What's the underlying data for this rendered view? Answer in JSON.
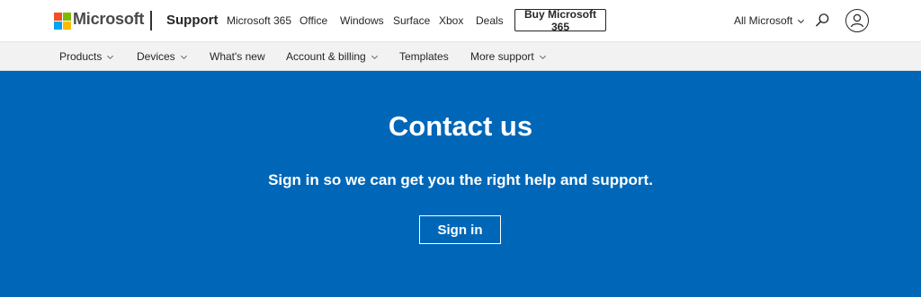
{
  "header": {
    "brand": "Microsoft",
    "section": "Support",
    "links": [
      "Microsoft 365",
      "Office",
      "Windows",
      "Surface",
      "Xbox",
      "Deals"
    ],
    "buy_button": "Buy Microsoft 365",
    "all_microsoft": "All Microsoft",
    "icons": [
      "microsoft-logo-icon",
      "chevron-down-icon",
      "search-icon",
      "account-icon"
    ]
  },
  "subnav": {
    "items": [
      {
        "label": "Products",
        "has_dropdown": true
      },
      {
        "label": "Devices",
        "has_dropdown": true
      },
      {
        "label": "What's new",
        "has_dropdown": false
      },
      {
        "label": "Account & billing",
        "has_dropdown": true
      },
      {
        "label": "Templates",
        "has_dropdown": false
      },
      {
        "label": "More support",
        "has_dropdown": true
      }
    ]
  },
  "hero": {
    "title": "Contact us",
    "subtitle": "Sign in so we can get you the right help and support.",
    "button": "Sign in"
  },
  "colors": {
    "hero_background": "#0067b8",
    "logo_red": "#f25022",
    "logo_green": "#7fba00",
    "logo_blue": "#00a4ef",
    "logo_yellow": "#ffb900",
    "text_dark": "#262626",
    "subnav_background": "#f2f2f2"
  }
}
